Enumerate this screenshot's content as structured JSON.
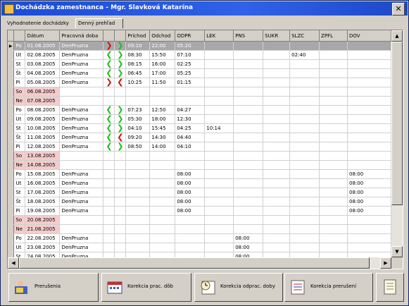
{
  "window": {
    "title": "Dochádzka zamestnanca - Mgr. Slavková Katarína"
  },
  "tabs": [
    {
      "label": "Vyhodnotenie dochádzky"
    },
    {
      "label": "Denný prehľad"
    }
  ],
  "columns": [
    "",
    "Dátum",
    "Pracovná doba",
    "",
    "",
    "Príchod",
    "Odchod",
    "ODPR",
    "LEK",
    "PNS",
    "SUKR",
    "SLZC",
    "ZPFL",
    "DOV"
  ],
  "rows": [
    {
      "day": "Po",
      "date": "01.08.2005",
      "shift": "DenPruzna",
      "a1": "r",
      "a2": "g",
      "arr": "09:10",
      "dep": "22:00",
      "odpr": "05:20",
      "lek": "",
      "pns": "",
      "sukr": "",
      "slzc": "",
      "zpfl": "",
      "dov": "",
      "weekend": false,
      "selected": true
    },
    {
      "day": "Ut",
      "date": "02.08.2005",
      "shift": "DenPruzna",
      "a1": "g",
      "a2": "g",
      "arr": "08:30",
      "dep": "15:50",
      "odpr": "07:10",
      "lek": "",
      "pns": "",
      "sukr": "",
      "slzc": "02:40",
      "zpfl": "",
      "dov": "",
      "weekend": false,
      "selected": false
    },
    {
      "day": "St",
      "date": "03.08.2005",
      "shift": "DenPruzna",
      "a1": "g",
      "a2": "g",
      "arr": "08:15",
      "dep": "16:00",
      "odpr": "02:25",
      "lek": "",
      "pns": "",
      "sukr": "",
      "slzc": "",
      "zpfl": "",
      "dov": "",
      "weekend": false,
      "selected": false
    },
    {
      "day": "Št",
      "date": "04.08.2005",
      "shift": "DenPruzna",
      "a1": "g",
      "a2": "g",
      "arr": "06:45",
      "dep": "17:00",
      "odpr": "05:25",
      "lek": "",
      "pns": "",
      "sukr": "",
      "slzc": "",
      "zpfl": "",
      "dov": "",
      "weekend": false,
      "selected": false
    },
    {
      "day": "Pi",
      "date": "05.08.2005",
      "shift": "DenPruzna",
      "a1": "r",
      "a2": "r",
      "arr": "10:25",
      "dep": "11:50",
      "odpr": "01:15",
      "lek": "",
      "pns": "",
      "sukr": "",
      "slzc": "",
      "zpfl": "",
      "dov": "",
      "weekend": false,
      "selected": false
    },
    {
      "day": "So",
      "date": "06.08.2005",
      "shift": "",
      "a1": "",
      "a2": "",
      "arr": "",
      "dep": "",
      "odpr": "",
      "lek": "",
      "pns": "",
      "sukr": "",
      "slzc": "",
      "zpfl": "",
      "dov": "",
      "weekend": true,
      "selected": false
    },
    {
      "day": "Ne",
      "date": "07.08.2005",
      "shift": "",
      "a1": "",
      "a2": "",
      "arr": "",
      "dep": "",
      "odpr": "",
      "lek": "",
      "pns": "",
      "sukr": "",
      "slzc": "",
      "zpfl": "",
      "dov": "",
      "weekend": true,
      "selected": false
    },
    {
      "day": "Po",
      "date": "08.08.2005",
      "shift": "DenPruzna",
      "a1": "g",
      "a2": "g",
      "arr": "07:23",
      "dep": "12:50",
      "odpr": "04:27",
      "lek": "",
      "pns": "",
      "sukr": "",
      "slzc": "",
      "zpfl": "",
      "dov": "",
      "weekend": false,
      "selected": false
    },
    {
      "day": "Ut",
      "date": "09.08.2005",
      "shift": "DenPruzna",
      "a1": "g",
      "a2": "g",
      "arr": "05:30",
      "dep": "18:00",
      "odpr": "12:30",
      "lek": "",
      "pns": "",
      "sukr": "",
      "slzc": "",
      "zpfl": "",
      "dov": "",
      "weekend": false,
      "selected": false
    },
    {
      "day": "St",
      "date": "10.08.2005",
      "shift": "DenPruzna",
      "a1": "g",
      "a2": "g",
      "arr": "04:10",
      "dep": "15:45",
      "odpr": "04:25",
      "lek": "10:14",
      "pns": "",
      "sukr": "",
      "slzc": "",
      "zpfl": "",
      "dov": "",
      "weekend": false,
      "selected": false
    },
    {
      "day": "Št",
      "date": "11.08.2005",
      "shift": "DenPruzna",
      "a1": "g",
      "a2": "r",
      "arr": "09:20",
      "dep": "14:30",
      "odpr": "04:40",
      "lek": "",
      "pns": "",
      "sukr": "",
      "slzc": "",
      "zpfl": "",
      "dov": "",
      "weekend": false,
      "selected": false
    },
    {
      "day": "Pi",
      "date": "12.08.2005",
      "shift": "DenPruzna",
      "a1": "g",
      "a2": "g",
      "arr": "08:50",
      "dep": "14:00",
      "odpr": "04:10",
      "lek": "",
      "pns": "",
      "sukr": "",
      "slzc": "",
      "zpfl": "",
      "dov": "",
      "weekend": false,
      "selected": false
    },
    {
      "day": "So",
      "date": "13.08.2005",
      "shift": "",
      "a1": "",
      "a2": "",
      "arr": "",
      "dep": "",
      "odpr": "",
      "lek": "",
      "pns": "",
      "sukr": "",
      "slzc": "",
      "zpfl": "",
      "dov": "",
      "weekend": true,
      "selected": false
    },
    {
      "day": "Ne",
      "date": "14.08.2005",
      "shift": "",
      "a1": "",
      "a2": "",
      "arr": "",
      "dep": "",
      "odpr": "",
      "lek": "",
      "pns": "",
      "sukr": "",
      "slzc": "",
      "zpfl": "",
      "dov": "",
      "weekend": true,
      "selected": false
    },
    {
      "day": "Po",
      "date": "15.08.2005",
      "shift": "DenPruzna",
      "a1": "",
      "a2": "",
      "arr": "",
      "dep": "",
      "odpr": "08:00",
      "lek": "",
      "pns": "",
      "sukr": "",
      "slzc": "",
      "zpfl": "",
      "dov": "08:00",
      "weekend": false,
      "selected": false
    },
    {
      "day": "Ut",
      "date": "16.08.2005",
      "shift": "DenPruzna",
      "a1": "",
      "a2": "",
      "arr": "",
      "dep": "",
      "odpr": "08:00",
      "lek": "",
      "pns": "",
      "sukr": "",
      "slzc": "",
      "zpfl": "",
      "dov": "08:00",
      "weekend": false,
      "selected": false
    },
    {
      "day": "St",
      "date": "17.08.2005",
      "shift": "DenPruzna",
      "a1": "",
      "a2": "",
      "arr": "",
      "dep": "",
      "odpr": "08:00",
      "lek": "",
      "pns": "",
      "sukr": "",
      "slzc": "",
      "zpfl": "",
      "dov": "08:00",
      "weekend": false,
      "selected": false
    },
    {
      "day": "Št",
      "date": "18.08.2005",
      "shift": "DenPruzna",
      "a1": "",
      "a2": "",
      "arr": "",
      "dep": "",
      "odpr": "08:00",
      "lek": "",
      "pns": "",
      "sukr": "",
      "slzc": "",
      "zpfl": "",
      "dov": "08:00",
      "weekend": false,
      "selected": false
    },
    {
      "day": "Pi",
      "date": "19.08.2005",
      "shift": "DenPruzna",
      "a1": "",
      "a2": "",
      "arr": "",
      "dep": "",
      "odpr": "08:00",
      "lek": "",
      "pns": "",
      "sukr": "",
      "slzc": "",
      "zpfl": "",
      "dov": "08:00",
      "weekend": false,
      "selected": false
    },
    {
      "day": "So",
      "date": "20.08.2005",
      "shift": "",
      "a1": "",
      "a2": "",
      "arr": "",
      "dep": "",
      "odpr": "",
      "lek": "",
      "pns": "",
      "sukr": "",
      "slzc": "",
      "zpfl": "",
      "dov": "",
      "weekend": true,
      "selected": false
    },
    {
      "day": "Ne",
      "date": "21.08.2005",
      "shift": "",
      "a1": "",
      "a2": "",
      "arr": "",
      "dep": "",
      "odpr": "",
      "lek": "",
      "pns": "",
      "sukr": "",
      "slzc": "",
      "zpfl": "",
      "dov": "",
      "weekend": true,
      "selected": false
    },
    {
      "day": "Po",
      "date": "22.08.2005",
      "shift": "DenPruzna",
      "a1": "",
      "a2": "",
      "arr": "",
      "dep": "",
      "odpr": "",
      "lek": "",
      "pns": "08:00",
      "sukr": "",
      "slzc": "",
      "zpfl": "",
      "dov": "",
      "weekend": false,
      "selected": false
    },
    {
      "day": "Ut",
      "date": "23.08.2005",
      "shift": "DenPruzna",
      "a1": "",
      "a2": "",
      "arr": "",
      "dep": "",
      "odpr": "",
      "lek": "",
      "pns": "08:00",
      "sukr": "",
      "slzc": "",
      "zpfl": "",
      "dov": "",
      "weekend": false,
      "selected": false
    },
    {
      "day": "St",
      "date": "24.08.2005",
      "shift": "DenPruzna",
      "a1": "",
      "a2": "",
      "arr": "",
      "dep": "",
      "odpr": "",
      "lek": "",
      "pns": "08:00",
      "sukr": "",
      "slzc": "",
      "zpfl": "",
      "dov": "",
      "weekend": false,
      "selected": false
    }
  ],
  "buttons": [
    {
      "label": "Prerušenia",
      "icon": "user-card-icon"
    },
    {
      "label": "Korekcia prac. dôb",
      "icon": "calendar-icon"
    },
    {
      "label": "Korekcia odprac. doby",
      "icon": "clock-edit-icon"
    },
    {
      "label": "Korekcia prerušení",
      "icon": "list-edit-icon"
    },
    {
      "label": "",
      "icon": "notepad-icon"
    }
  ],
  "colors": {
    "titlebar": "#1c4bd6",
    "weekend": "#f4cccc",
    "selected": "#a8a8a8",
    "arrow_ok": "#1bbf1b",
    "arrow_bad": "#d01010"
  }
}
